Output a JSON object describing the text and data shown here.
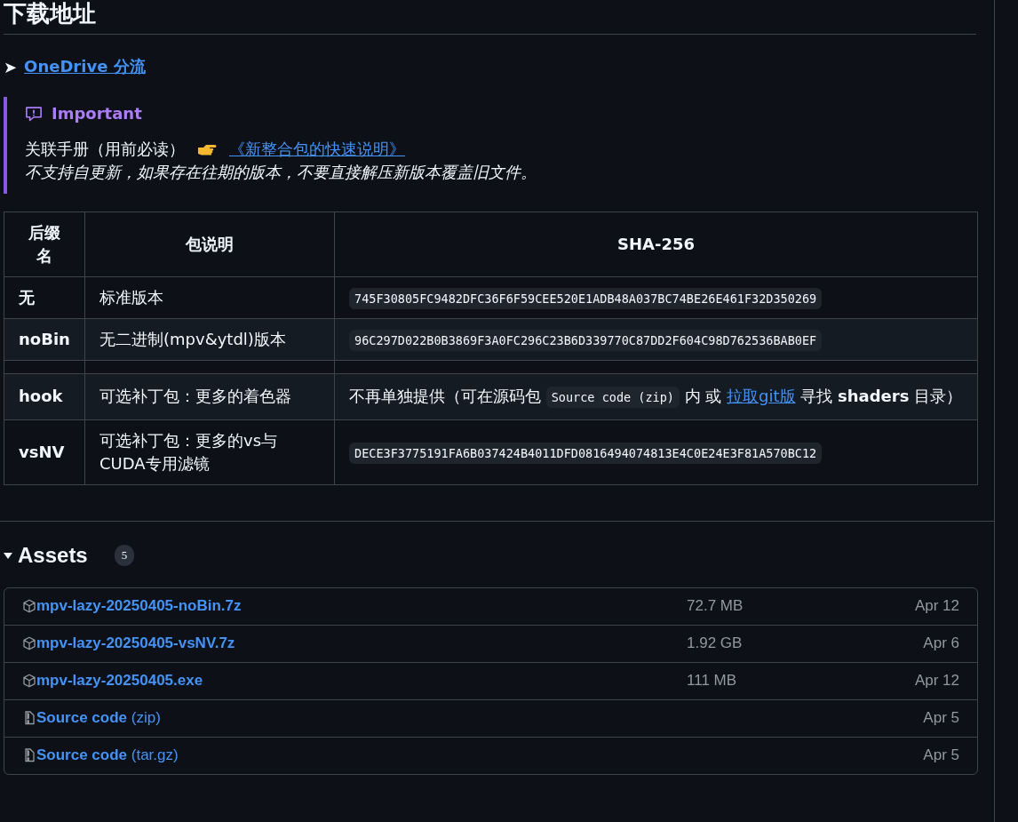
{
  "heading": "下载地址",
  "mirror": {
    "bullet": "➤",
    "link": "OneDrive 分流"
  },
  "callout": {
    "title": "Important",
    "line_1_text": "关联手册（用前必读）",
    "line_1_link": "《新整合包的快速说明》",
    "line_2": "不支持自更新，如果存在往期的版本，不要直接解压新版本覆盖旧文件。"
  },
  "table": {
    "columns": [
      "后缀名",
      "包说明",
      "SHA-256"
    ],
    "rows": [
      {
        "kind": "hash",
        "suffix": "无",
        "description": "标准版本",
        "sha": "745F30805FC9482DFC36F6F59CEE520E1ADB48A037BC74BE26E461F32D350269"
      },
      {
        "kind": "hash",
        "suffix": "noBin",
        "description": "无二进制(mpv&ytdl)版本",
        "sha": "96C297D022B0B3869F3A0FC296C23B6D339770C87DD2F604C98D762536BAB0EF"
      },
      {
        "kind": "empty"
      },
      {
        "kind": "note",
        "suffix": "hook",
        "description": "可选补丁包：更多的着色器",
        "note": [
          {
            "kind": "text",
            "text": "不再单独提供（可在源码包 "
          },
          {
            "kind": "code",
            "text": "Source code (zip)"
          },
          {
            "kind": "text",
            "text": " 内 或 "
          },
          {
            "kind": "link",
            "text": "拉取git版"
          },
          {
            "kind": "text",
            "text": " 寻找 **shaders** 目录）"
          }
        ]
      },
      {
        "kind": "hash",
        "suffix": "vsNV",
        "description": "可选补丁包：更多的vs与CUDA专用滤镜",
        "sha": "DECE3F3775191FA6B037424B4011DFD0816494074813E4C0E24E3F81A570BC12"
      }
    ]
  },
  "assets": {
    "title": "Assets",
    "count": "5",
    "expanded": true,
    "items": [
      {
        "kind": "package",
        "name": "mpv-lazy-20250405-noBin.7z",
        "size": "72.7 MB",
        "date": "Apr 12"
      },
      {
        "kind": "package",
        "name": "mpv-lazy-20250405-vsNV.7z",
        "size": "1.92 GB",
        "date": "Apr 6"
      },
      {
        "kind": "package",
        "name": "mpv-lazy-20250405.exe",
        "size": "111 MB",
        "date": "Apr 12"
      },
      {
        "kind": "source",
        "name": "Source code",
        "detail": "(zip)",
        "date": "Apr 5"
      },
      {
        "kind": "source",
        "name": "Source code",
        "detail": "(tar.gz)",
        "date": "Apr 5"
      }
    ]
  }
}
